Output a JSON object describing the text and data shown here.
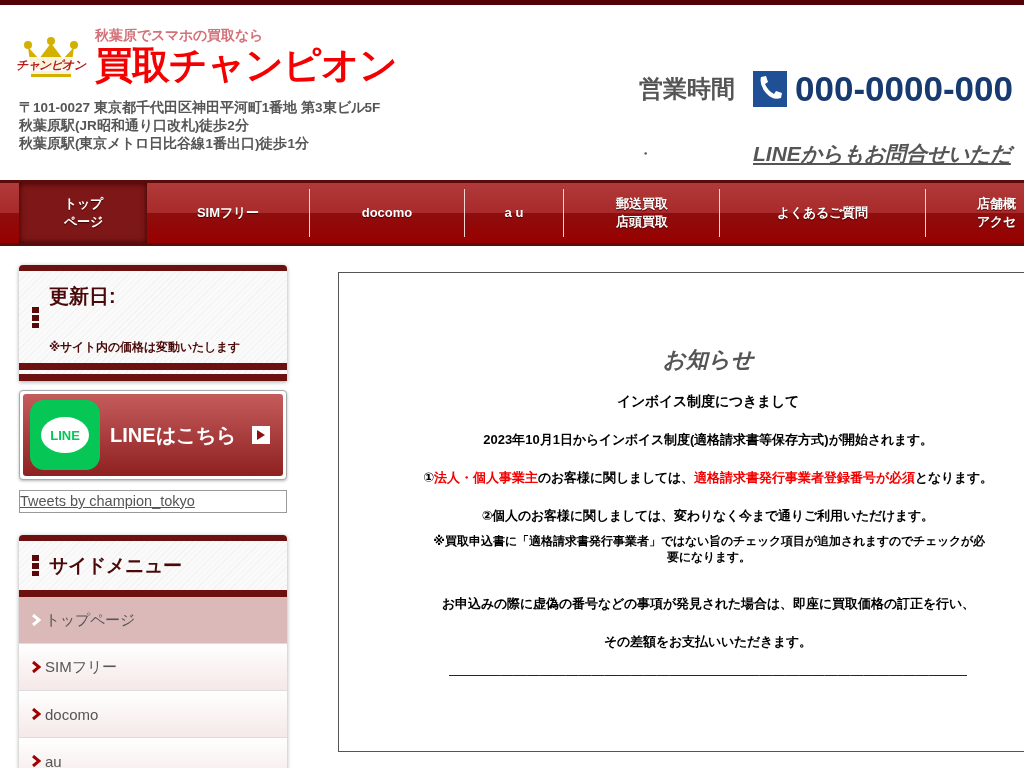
{
  "header": {
    "tagline": "秋葉原でスマホの買取なら",
    "logo_text": "チャンピオン",
    "site_name": "買取チャンピオン",
    "address_lines": [
      "〒101-0027 東京都千代田区神田平河町1番地 第3東ビル5F",
      "秋葉原駅(JR昭和通り口改札)徒歩2分",
      "秋葉原駅(東京メトロ日比谷線1番出口)徒歩1分"
    ],
    "hours_label": "営業時間",
    "hours_value": "・",
    "phone": "000-0000-000",
    "line_link": "LINEからもお問合せいただ"
  },
  "nav": [
    {
      "lines": [
        "トップ",
        "ページ"
      ],
      "selected": true
    },
    {
      "lines": [
        "SIMフリー"
      ],
      "selected": false
    },
    {
      "lines": [
        "docomo"
      ],
      "selected": false
    },
    {
      "lines": [
        "a u"
      ],
      "selected": false
    },
    {
      "lines": [
        "郵送買取",
        "店頭買取"
      ],
      "selected": false
    },
    {
      "lines": [
        "よくあるご質問"
      ],
      "selected": false
    },
    {
      "lines": [
        "店舗概",
        "アクセ"
      ],
      "selected": false
    }
  ],
  "sidebar": {
    "update_title": "更新日:",
    "update_note": "※サイト内の価格は変動いたします",
    "line_button": "LINEはこちら",
    "line_logo_text": "LINE",
    "tweets_link": "Tweets by champion_tokyo",
    "menu_title": "サイドメニュー",
    "menu_items": [
      {
        "label": "トップページ",
        "selected": true
      },
      {
        "label": "SIMフリー",
        "selected": false
      },
      {
        "label": "docomo",
        "selected": false
      },
      {
        "label": "au",
        "selected": false
      }
    ]
  },
  "notice": {
    "title": "お知らせ",
    "subtitle": "インボイス制度につきまして",
    "lines": [
      [
        {
          "text": "2023年10月1日からインボイス制度(適格請求書等保存方式)が開始されます。",
          "highlight": false
        }
      ],
      [
        {
          "text": "①",
          "highlight": false
        },
        {
          "text": "法人・個人事業主",
          "highlight": true
        },
        {
          "text": "のお客様に関しましては、",
          "highlight": false
        },
        {
          "text": "適格請求書発行事業者登録番号が必須",
          "highlight": true
        },
        {
          "text": "となります。",
          "highlight": false
        }
      ],
      [
        {
          "text": "②個人のお客様に関しましては、変わりなく今まで通りご利用いただけます。",
          "highlight": false
        }
      ]
    ],
    "small_note": "※買取申込書に「適格請求書発行事業者」ではない旨のチェック項目が追加されますのでチェックが必要になります。",
    "warning_lines": [
      "お申込みの際に虚偽の番号などの事項が発見された場合は、即座に買取価格の訂正を行い、",
      "その差額をお支払いいただきます。"
    ],
    "divider_text": "――――――――――――――――――――――――――――――――――――――――"
  }
}
